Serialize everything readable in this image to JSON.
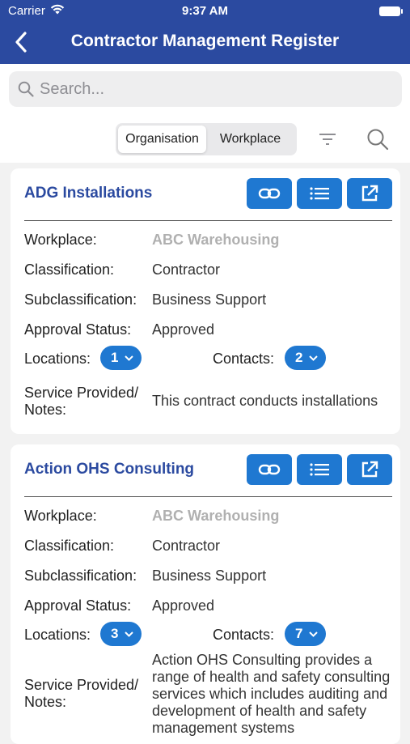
{
  "status_bar": {
    "carrier": "Carrier",
    "time": "9:37 AM"
  },
  "nav": {
    "title": "Contractor Management Register"
  },
  "search": {
    "placeholder": "Search..."
  },
  "segments": {
    "organisation": "Organisation",
    "workplace": "Workplace",
    "selected": "Organisation"
  },
  "labels": {
    "workplace": "Workplace:",
    "classification": "Classification:",
    "subclassification": "Subclassification:",
    "approval_status": "Approval Status:",
    "locations": "Locations:",
    "contacts": "Contacts:",
    "notes": "Service Provided/\nNotes:"
  },
  "cards": [
    {
      "name": "ADG Installations",
      "workplace": "ABC Warehousing",
      "classification": "Contractor",
      "subclassification": "Business Support",
      "approval_status": "Approved",
      "locations": "1",
      "contacts": "2",
      "notes": "This contract conducts installations"
    },
    {
      "name": "Action OHS Consulting",
      "workplace": "ABC Warehousing",
      "classification": "Contractor",
      "subclassification": "Business Support",
      "approval_status": "Approved",
      "locations": "3",
      "contacts": "7",
      "notes": "Action OHS Consulting provides a range of health and safety consulting services which includes auditing and development of health and safety management systems"
    }
  ],
  "colors": {
    "nav_bg": "#2b4aa0",
    "accent": "#1f78d1",
    "title": "#2b4aa0"
  }
}
